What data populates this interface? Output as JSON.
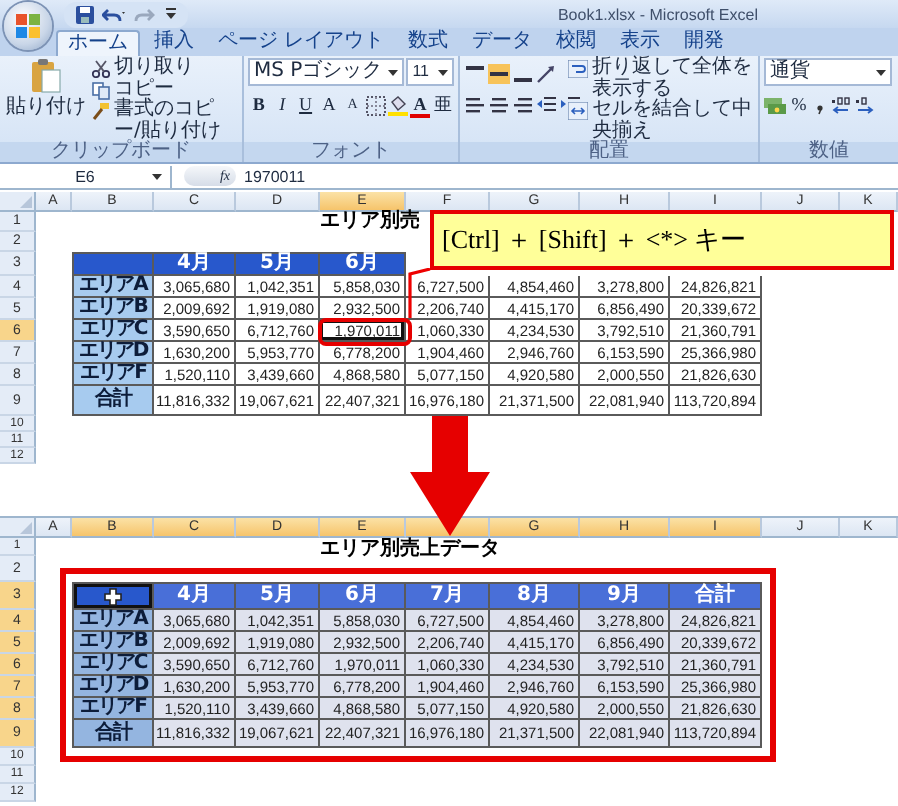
{
  "top": {
    "title_bar": {
      "title": "Book1.xlsx - Microsoft Excel"
    },
    "tabs": [
      {
        "label": "ホーム",
        "selected": true
      },
      {
        "label": "挿入",
        "selected": false
      },
      {
        "label": "ページ レイアウト",
        "selected": false
      },
      {
        "label": "数式",
        "selected": false
      },
      {
        "label": "データ",
        "selected": false
      },
      {
        "label": "校閲",
        "selected": false
      },
      {
        "label": "表示",
        "selected": false
      },
      {
        "label": "開発",
        "selected": false
      }
    ],
    "clipboard": {
      "paste": "貼り付け",
      "cut": "切り取り",
      "copy": "コピー",
      "format_painter": "書式のコピー/貼り付け",
      "group_label": "クリップボード"
    },
    "font": {
      "name": "MS Pゴシック",
      "size": "11",
      "bold": "B",
      "italic": "I",
      "underline": "U",
      "grow": "A",
      "shrink": "A",
      "font_color": "A",
      "phonetic": "亜",
      "group_label": "フォント"
    },
    "alignment": {
      "vertical_buttons": [
        {
          "selected": false
        },
        {
          "selected": true
        },
        {
          "selected": false
        }
      ],
      "wrap": "折り返して全体を表示する",
      "merge": "セルを結合して中央揃え",
      "group_label": "配置"
    },
    "number": {
      "format": "通貨",
      "percent": "%",
      "group_label": "数値"
    },
    "formula_bar": {
      "cell": "E6",
      "fx": "fx",
      "value": "1970011"
    },
    "columns": [
      {
        "label": "A",
        "selected": false
      },
      {
        "label": "B",
        "selected": false
      },
      {
        "label": "C",
        "selected": false
      },
      {
        "label": "D",
        "selected": false
      },
      {
        "label": "E",
        "selected": true
      },
      {
        "label": "F",
        "selected": false
      },
      {
        "label": "G",
        "selected": false
      },
      {
        "label": "H",
        "selected": false
      },
      {
        "label": "I",
        "selected": false
      },
      {
        "label": "J",
        "selected": false
      },
      {
        "label": "K",
        "selected": false
      }
    ],
    "rows": [
      {
        "number": "1",
        "selected": false
      },
      {
        "number": "2",
        "selected": false
      },
      {
        "number": "3",
        "selected": false
      },
      {
        "number": "4",
        "selected": false
      },
      {
        "number": "5",
        "selected": false
      },
      {
        "number": "6",
        "selected": true
      },
      {
        "number": "7",
        "selected": false
      },
      {
        "number": "8",
        "selected": false
      },
      {
        "number": "9",
        "selected": false
      },
      {
        "number": "10",
        "selected": false
      },
      {
        "number": "11",
        "selected": false
      },
      {
        "number": "12",
        "selected": false
      }
    ],
    "sheet_title": "エリア別売",
    "table": {
      "header": [
        "4月",
        "5月",
        "6月"
      ],
      "rows": [
        {
          "label": "エリアA",
          "values": [
            "3,065,680",
            "1,042,351",
            "5,858,030",
            "6,727,500",
            "4,854,460",
            "3,278,800",
            "24,826,821"
          ]
        },
        {
          "label": "エリアB",
          "values": [
            "2,009,692",
            "1,919,080",
            "2,932,500",
            "2,206,740",
            "4,415,170",
            "6,856,490",
            "20,339,672"
          ]
        },
        {
          "label": "エリアC",
          "values": [
            "3,590,650",
            "6,712,760",
            "1,970,011",
            "1,060,330",
            "4,234,530",
            "3,792,510",
            "21,360,791"
          ]
        },
        {
          "label": "エリアD",
          "values": [
            "1,630,200",
            "5,953,770",
            "6,778,200",
            "1,904,460",
            "2,946,760",
            "6,153,590",
            "25,366,980"
          ]
        },
        {
          "label": "エリアF",
          "values": [
            "1,520,110",
            "3,439,660",
            "4,868,580",
            "5,077,150",
            "4,920,580",
            "2,000,550",
            "21,826,630"
          ]
        },
        {
          "label": "合計",
          "values": [
            "11,816,332",
            "19,067,621",
            "22,407,321",
            "16,976,180",
            "21,371,500",
            "22,081,940",
            "113,720,894"
          ]
        }
      ]
    },
    "callout": "[Ctrl] ＋ [Shift] ＋ <*> キー"
  },
  "bottom": {
    "columns": [
      {
        "label": "A",
        "selected": false
      },
      {
        "label": "B",
        "selected": true
      },
      {
        "label": "C",
        "selected": true
      },
      {
        "label": "D",
        "selected": true
      },
      {
        "label": "E",
        "selected": true
      },
      {
        "selected": true
      },
      {
        "label": "G",
        "selected": true
      },
      {
        "label": "H",
        "selected": true
      },
      {
        "label": "I",
        "selected": true
      },
      {
        "label": "J",
        "selected": false
      },
      {
        "label": "K",
        "selected": false
      }
    ],
    "rows": [
      {
        "number": "1",
        "selected": false
      },
      {
        "number": "2",
        "selected": false
      },
      {
        "number": "3",
        "selected": true
      },
      {
        "number": "4",
        "selected": true
      },
      {
        "number": "5",
        "selected": true
      },
      {
        "number": "6",
        "selected": true
      },
      {
        "number": "7",
        "selected": true
      },
      {
        "number": "8",
        "selected": true
      },
      {
        "number": "9",
        "selected": true
      },
      {
        "number": "10",
        "selected": false
      },
      {
        "number": "11",
        "selected": false
      },
      {
        "number": "12",
        "selected": false
      }
    ],
    "sheet_title": "エリア別売上データ",
    "table": {
      "header": [
        "4月",
        "5月",
        "6月",
        "7月",
        "8月",
        "9月",
        "合計"
      ],
      "rows": [
        {
          "label": "エリアA",
          "values": [
            "3,065,680",
            "1,042,351",
            "5,858,030",
            "6,727,500",
            "4,854,460",
            "3,278,800",
            "24,826,821"
          ]
        },
        {
          "label": "エリアB",
          "values": [
            "2,009,692",
            "1,919,080",
            "2,932,500",
            "2,206,740",
            "4,415,170",
            "6,856,490",
            "20,339,672"
          ]
        },
        {
          "label": "エリアC",
          "values": [
            "3,590,650",
            "6,712,760",
            "1,970,011",
            "1,060,330",
            "4,234,530",
            "3,792,510",
            "21,360,791"
          ]
        },
        {
          "label": "エリアD",
          "values": [
            "1,630,200",
            "5,953,770",
            "6,778,200",
            "1,904,460",
            "2,946,760",
            "6,153,590",
            "25,366,980"
          ]
        },
        {
          "label": "エリアF",
          "values": [
            "1,520,110",
            "3,439,660",
            "4,868,580",
            "5,077,150",
            "4,920,580",
            "2,000,550",
            "21,826,630"
          ]
        },
        {
          "label": "合計",
          "values": [
            "11,816,332",
            "19,067,621",
            "22,407,321",
            "16,976,180",
            "21,371,500",
            "22,081,940",
            "113,720,894"
          ]
        }
      ]
    }
  }
}
